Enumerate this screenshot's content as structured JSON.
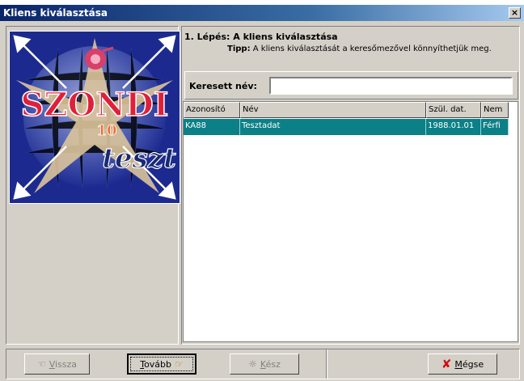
{
  "window": {
    "title": "Kliens kiválasztása",
    "close_glyph": "×"
  },
  "logo": {
    "word": "SZONDI",
    "number": "10",
    "script": "teszt"
  },
  "step": {
    "title": "1. Lépés: A kliens kiválasztása",
    "tip_label": "Tipp:",
    "tip_text": "A kliens kiválasztását a keresőmezővel könnyíthetjük meg."
  },
  "search": {
    "label": "Keresett név:",
    "value": ""
  },
  "grid": {
    "columns": [
      "Azonosító",
      "Név",
      "Szül. dat.",
      "Nem"
    ],
    "rows": [
      {
        "id": "KA88",
        "name": "Tesztadat",
        "birth": "1988.01.01",
        "sex": "Férfi"
      }
    ],
    "selected_row_color": "#0b8087"
  },
  "buttons": {
    "back": {
      "label_prefix": "",
      "label_underline": "V",
      "label_rest": "issza",
      "icon": "hand-left-icon"
    },
    "next": {
      "label_prefix": "",
      "label_underline": "T",
      "label_rest": "ovább",
      "icon": "hand-right-icon"
    },
    "done": {
      "label_prefix": "",
      "label_underline": "K",
      "label_rest": "ész",
      "icon": "lightbulb-icon"
    },
    "cancel": {
      "label_prefix": "",
      "label_underline": "M",
      "label_rest": "égse",
      "icon": "red-x-icon"
    }
  }
}
